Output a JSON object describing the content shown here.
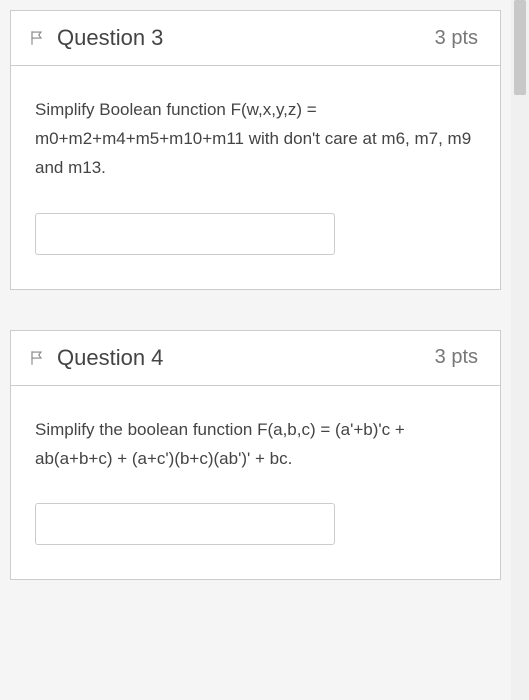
{
  "questions": [
    {
      "title": "Question 3",
      "points": "3 pts",
      "prompt": "Simplify Boolean function F(w,x,y,z) = m0+m2+m4+m5+m10+m11 with don't care at m6, m7, m9 and m13.",
      "answer": ""
    },
    {
      "title": "Question 4",
      "points": "3 pts",
      "prompt": "Simplify the boolean function F(a,b,c) = (a'+b)'c + ab(a+b+c) + (a+c')(b+c)(ab')' + bc.",
      "answer": ""
    }
  ]
}
